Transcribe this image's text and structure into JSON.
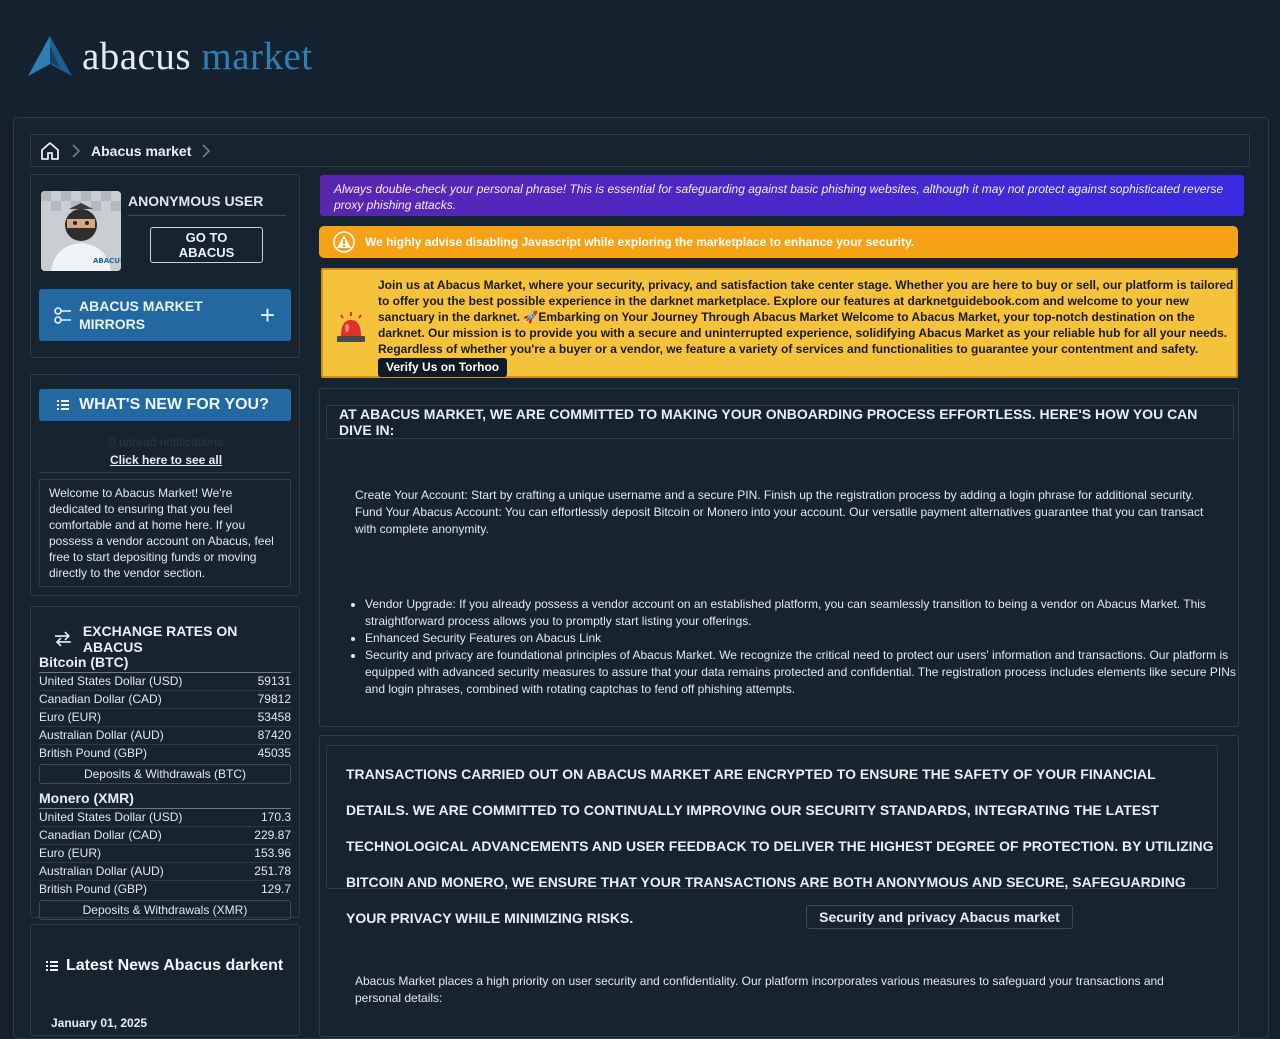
{
  "brand": {
    "word1": "abacus",
    "word2": "market"
  },
  "breadcrumb": {
    "crumb": "Abacus market"
  },
  "user": {
    "name": "ANONYMOUS USER",
    "goto_label": "GO TO ABACUS",
    "mirrors_label": "ABACUS MARKET MIRRORS"
  },
  "whats_new": {
    "title": "WHAT'S NEW FOR YOU?",
    "unread": "0 unread notifications",
    "see_all": "Click here to see all",
    "welcome": "Welcome to Abacus Market! We're dedicated to ensuring that you feel comfortable and at home here. If you possess a vendor account on Abacus, feel free to start depositing funds or moving directly to the vendor section."
  },
  "exchange": {
    "title": "EXCHANGE RATES ON ABACUS",
    "btc": {
      "name": "Bitcoin (BTC)",
      "rows": [
        {
          "label": "United States Dollar (USD)",
          "value": "59131"
        },
        {
          "label": "Canadian Dollar (CAD)",
          "value": "79812"
        },
        {
          "label": "Euro (EUR)",
          "value": "53458"
        },
        {
          "label": "Australian Dollar (AUD)",
          "value": "87420"
        },
        {
          "label": "British Pound (GBP)",
          "value": "45035"
        }
      ],
      "button": "Deposits & Withdrawals (BTC)"
    },
    "xmr": {
      "name": "Monero (XMR)",
      "rows": [
        {
          "label": "United States Dollar (USD)",
          "value": "170.3"
        },
        {
          "label": "Canadian Dollar (CAD)",
          "value": "229.87"
        },
        {
          "label": "Euro (EUR)",
          "value": "153.96"
        },
        {
          "label": "Australian Dollar (AUD)",
          "value": "251.78"
        },
        {
          "label": "British Pound (GBP)",
          "value": "129.7"
        }
      ],
      "button": "Deposits & Withdrawals (XMR)"
    }
  },
  "news": {
    "title": "Latest News Abacus darkent",
    "date": "January 01, 2025"
  },
  "notices": {
    "phishing": "Always double-check your personal phrase! This is essential for safeguarding against basic phishing websites, although it may not protect against sophisticated reverse proxy phishing attacks.",
    "javascript": "We highly advise disabling Javascript while exploring the marketplace to enhance your security.",
    "welcome": "Join us at Abacus Market, where your security, privacy, and satisfaction take center stage. Whether you are here to buy or sell, our platform is tailored to offer you the best possible experience in the darknet marketplace. Explore our features at darknetguidebook.com and welcome to your new sanctuary in the darknet. 🚀Embarking on Your Journey Through Abacus Market Welcome to Abacus Market, your top-notch destination on the darknet. Our mission is to provide you with a secure and uninterrupted experience, solidifying Abacus Market as your reliable hub for all your needs. Regardless of whether you're a buyer or a vendor, we feature a variety of services and functionalities to guarantee your contentment and safety.",
    "verify": "Verify Us on Torhoo"
  },
  "onboarding": {
    "heading": "AT ABACUS MARKET, WE ARE COMMITTED TO MAKING YOUR ONBOARDING PROCESS EFFORTLESS. HERE'S HOW YOU CAN DIVE IN:",
    "paragraph": "Create Your Account: Start by crafting a unique username and a secure PIN. Finish up the registration process by adding a login phrase for additional security. Fund Your Abacus Account: You can effortlessly deposit Bitcoin or Monero into your account. Our versatile payment alternatives guarantee that you can transact with complete anonymity.",
    "list": [
      "Vendor Upgrade: If you already possess a vendor account on an established platform, you can seamlessly transition to being a vendor on Abacus Market. This straightforward process allows you to promptly start listing your offerings.",
      "Enhanced Security Features on Abacus Link",
      "Security and privacy are foundational principles of Abacus Market. We recognize the critical need to protect our users' information and transactions. Our platform is equipped with advanced security measures to assure that your data remains protected and confidential. The registration process includes elements like secure PINs and login phrases, combined with rotating captchas to fend off phishing attempts."
    ]
  },
  "transactions": {
    "heading": "TRANSACTIONS CARRIED OUT ON ABACUS MARKET ARE ENCRYPTED TO ENSURE THE SAFETY OF YOUR FINANCIAL DETAILS. WE ARE COMMITTED TO CONTINUALLY IMPROVING OUR SECURITY STANDARDS, INTEGRATING THE LATEST TECHNOLOGICAL ADVANCEMENTS AND USER FEEDBACK TO DELIVER THE HIGHEST DEGREE OF PROTECTION. BY UTILIZING BITCOIN AND MONERO, WE ENSURE THAT YOUR TRANSACTIONS ARE BOTH ANONYMOUS AND SECURE, SAFEGUARDING YOUR PRIVACY WHILE MINIMIZING RISKS.",
    "pill": "Security and privacy Abacus market",
    "paragraph": "Abacus Market places a high priority on user security and confidentiality. Our platform incorporates various measures to safeguard your transactions and personal details:"
  },
  "colors": {
    "accent": "#2368a1",
    "background": "#16202a",
    "warning": "#f5a216",
    "notice": "#f5c33b",
    "phishing": "#5b25b0"
  },
  "icons": [
    "abacus-logo-icon",
    "home-icon",
    "chevron-right-icon",
    "mirror-link-icon",
    "plus-icon",
    "list-icon",
    "exchange-icon",
    "warning-icon",
    "siren-icon"
  ]
}
